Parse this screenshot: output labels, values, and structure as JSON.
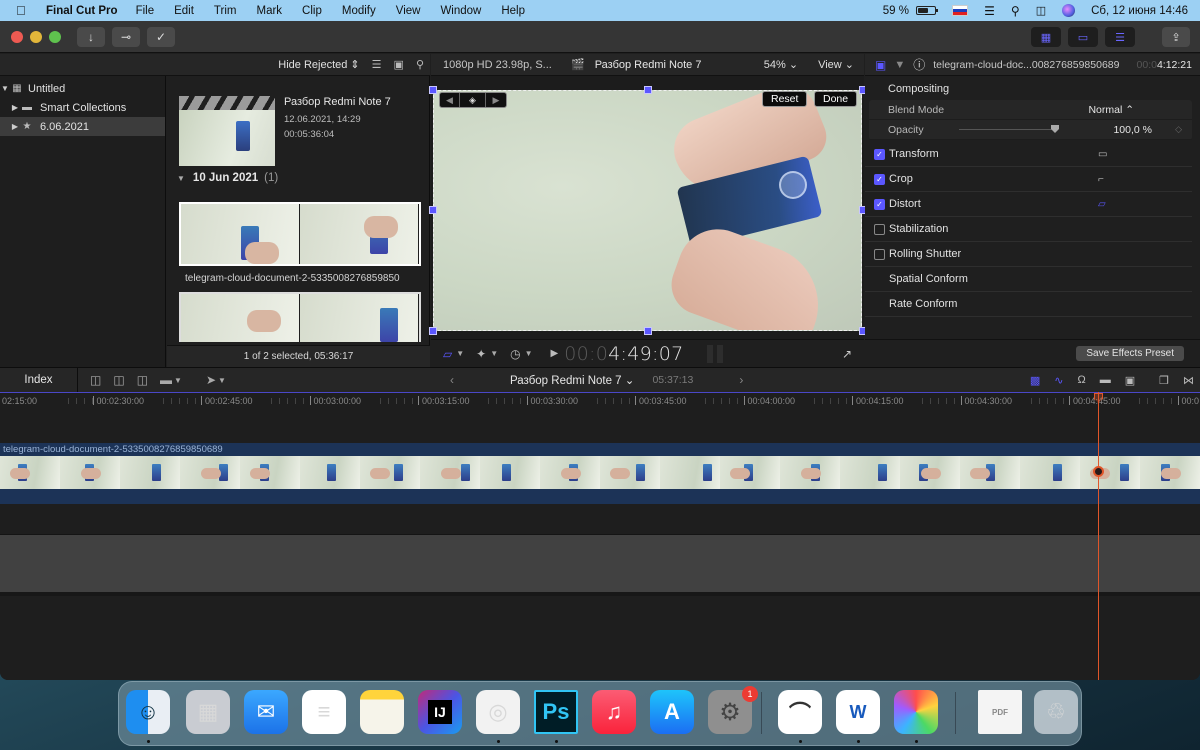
{
  "menubar": {
    "app_name": "Final Cut Pro",
    "menus": [
      "File",
      "Edit",
      "Trim",
      "Mark",
      "Clip",
      "Modify",
      "View",
      "Window",
      "Help"
    ],
    "battery_percent_label": "59 %",
    "battery_level": 0.59,
    "datetime": "Сб, 12 июня  14:46",
    "icons": [
      "apple-icon",
      "battery-icon",
      "russian-flag-input-icon",
      "wifi-icon",
      "spotlight-search-icon",
      "control-center-icon",
      "siri-icon"
    ]
  },
  "toolbar": {
    "traffic_lights": {
      "close": "#ee5a52",
      "minimize": "#e2b63a",
      "zoom": "#5fc24e"
    },
    "buttons": [
      {
        "name": "import-button",
        "icon": "↓"
      },
      {
        "name": "keywords-button",
        "icon": "⊶"
      },
      {
        "name": "background-tasks-button",
        "icon": "✓"
      }
    ],
    "right_buttons": [
      {
        "name": "show-browser-button",
        "icon": "▦"
      },
      {
        "name": "show-timeline-button",
        "icon": "▭"
      },
      {
        "name": "show-inspector-button",
        "icon": "☰"
      }
    ],
    "share_icon": "⇪"
  },
  "libraries": {
    "header_icons": [
      "photos-and-videos-icon",
      "music-and-sound-icon",
      "titles-and-generators-icon"
    ],
    "items": [
      {
        "label": "Untitled",
        "expanded": true,
        "selected": false,
        "glyph": "▦",
        "indent": 0
      },
      {
        "label": "Smart Collections",
        "expanded": false,
        "selected": false,
        "glyph": "▬",
        "indent": 1
      },
      {
        "label": "6.06.2021",
        "expanded": false,
        "selected": true,
        "glyph": "★",
        "indent": 1
      }
    ]
  },
  "browser": {
    "filter_label": "Hide Rejected",
    "project": {
      "name": "Разбор Redmi Note 7",
      "date": "12.06.2021, 14:29",
      "duration": "00:05:36:04"
    },
    "group": {
      "label": "10 Jun 2021",
      "count": "(1)"
    },
    "clip_name": "telegram-cloud-document-2-5335008276859850",
    "status": "1 of 2 selected, 05:36:17"
  },
  "viewer": {
    "format": "1080p HD 23.98p, S...",
    "title": "Разбор Redmi Note 7",
    "zoom": "54%",
    "view_label": "View",
    "reset_label": "Reset",
    "done_label": "Done",
    "timecode_dim": "00:0",
    "timecode": "4:49:07"
  },
  "inspector": {
    "clip_name": "telegram-cloud-doc...008276859850689",
    "timecode_dim": "00:0",
    "timecode": "4:12:21",
    "section": "Compositing",
    "blend_mode_label": "Blend Mode",
    "blend_mode_value": "Normal ⌃",
    "opacity_label": "Opacity",
    "opacity_value": "100,0  %",
    "opacity_fraction": 1.0,
    "effects": [
      {
        "label": "Transform",
        "checked": true,
        "icon": "transform-icon",
        "glyph": "▭"
      },
      {
        "label": "Crop",
        "checked": true,
        "icon": "crop-icon",
        "glyph": "⌐"
      },
      {
        "label": "Distort",
        "checked": true,
        "icon": "distort-icon",
        "glyph": "▱"
      },
      {
        "label": "Stabilization",
        "checked": false,
        "icon": null,
        "glyph": ""
      },
      {
        "label": "Rolling Shutter",
        "checked": false,
        "icon": null,
        "glyph": ""
      },
      {
        "label": "Spatial Conform",
        "checked": null,
        "icon": null,
        "glyph": ""
      },
      {
        "label": "Rate Conform",
        "checked": null,
        "icon": null,
        "glyph": ""
      }
    ],
    "save_preset_label": "Save Effects Preset"
  },
  "timeline": {
    "index_label": "Index",
    "project_name": "Разбор Redmi Note 7",
    "project_duration": "05:37:13",
    "ruler_labels": [
      "02:15:00",
      "00:02:30:00",
      "00:02:45:00",
      "00:03:00:00",
      "00:03:15:00",
      "00:03:30:00",
      "00:03:45:00",
      "00:04:00:00",
      "00:04:15:00",
      "00:04:30:00",
      "00:04:45:00",
      "00:0"
    ],
    "clip_name": "telegram-cloud-document-2-5335008276859850689",
    "accent": "#5b57ff",
    "playhead_color": "#e0562a"
  },
  "dock": {
    "apps": [
      {
        "name": "Finder",
        "running": true
      },
      {
        "name": "Launchpad",
        "running": false
      },
      {
        "name": "Mail",
        "running": false
      },
      {
        "name": "Reminders",
        "running": false
      },
      {
        "name": "Notes",
        "running": false
      },
      {
        "name": "IntelliJ IDEA",
        "running": false,
        "label": "IJ"
      },
      {
        "name": "Google Chrome",
        "running": true
      },
      {
        "name": "Photoshop",
        "running": true,
        "label": "Ps"
      },
      {
        "name": "Music",
        "running": false
      },
      {
        "name": "App Store",
        "running": false
      },
      {
        "name": "System Preferences",
        "running": false,
        "badge": "1"
      },
      {
        "name": "System Information",
        "running": true
      },
      {
        "name": "Microsoft Word",
        "running": true,
        "label": "W"
      },
      {
        "name": "Final Cut Pro",
        "running": true
      },
      {
        "name": "PDF Document",
        "running": false,
        "label": "PDF"
      },
      {
        "name": "Trash",
        "running": false
      }
    ]
  }
}
